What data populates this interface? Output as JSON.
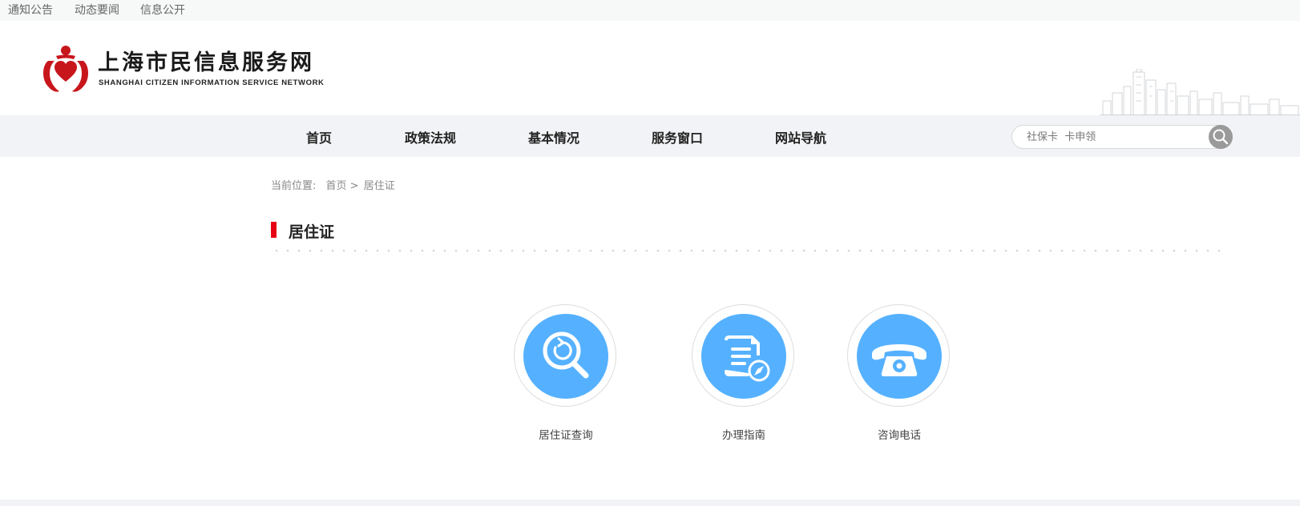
{
  "top_links": [
    "通知公告",
    "动态要闻",
    "信息公开"
  ],
  "header": {
    "logo_cn": "上海市民信息服务网",
    "logo_en": "SHANGHAI CITIZEN INFORMATION SERVICE NETWORK"
  },
  "nav": {
    "items": [
      "首页",
      "政策法规",
      "基本情况",
      "服务窗口",
      "网站导航"
    ]
  },
  "search": {
    "placeholder": "社保卡  卡申领"
  },
  "breadcrumb": {
    "label": "当前位置:",
    "home": "首页 >",
    "current": "居住证"
  },
  "section": {
    "title": "居住证"
  },
  "tiles": [
    {
      "icon": "search-refresh-icon",
      "label": "居住证查询"
    },
    {
      "icon": "document-guide-icon",
      "label": "办理指南"
    },
    {
      "icon": "telephone-icon",
      "label": "咨询电话"
    }
  ],
  "colors": {
    "accent_red": "#e60012",
    "tile_blue": "#55b1ff",
    "nav_bg": "#f2f3f6"
  }
}
